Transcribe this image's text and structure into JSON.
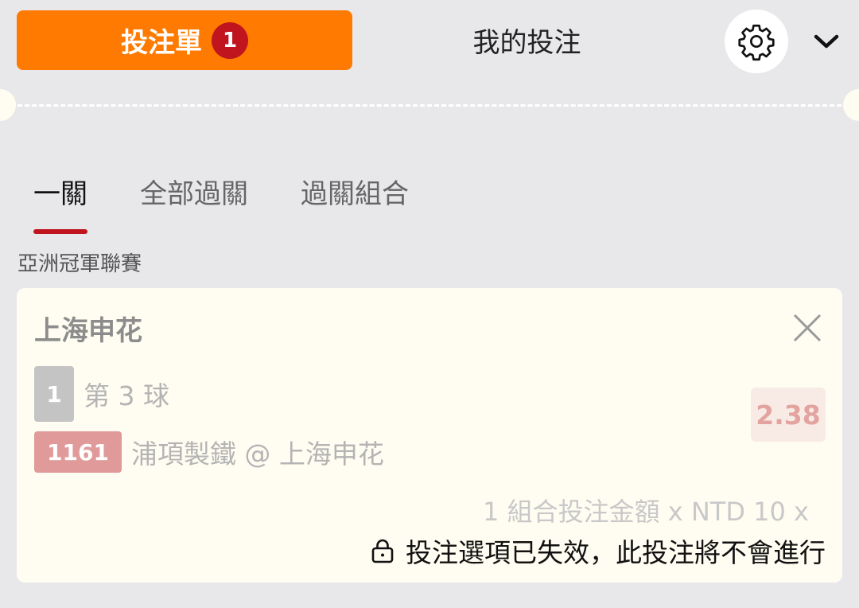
{
  "header": {
    "betslip_label": "投注單",
    "betslip_count": "1",
    "mybets_label": "我的投注",
    "settings_icon": "gear-icon",
    "collapse_icon": "chevron-down-icon"
  },
  "subtabs": [
    {
      "label": "一關",
      "active": true
    },
    {
      "label": "全部過關",
      "active": false
    },
    {
      "label": "過關組合",
      "active": false
    }
  ],
  "league": "亞洲冠軍聯賽",
  "bet": {
    "team": "上海申花",
    "selection_number": "1",
    "market": "第 3 球",
    "match_id": "1161",
    "matchup": "浦項製鐵 @ 上海申花",
    "odds": "2.38",
    "stake_text": "1 組合投注金額 x NTD 10 x",
    "warning": "投注選項已失效，此投注將不會進行"
  },
  "colors": {
    "accent": "#ff7a00",
    "badge": "#c0151e",
    "background": "#e8e8eb",
    "card": "#fffdf1"
  }
}
